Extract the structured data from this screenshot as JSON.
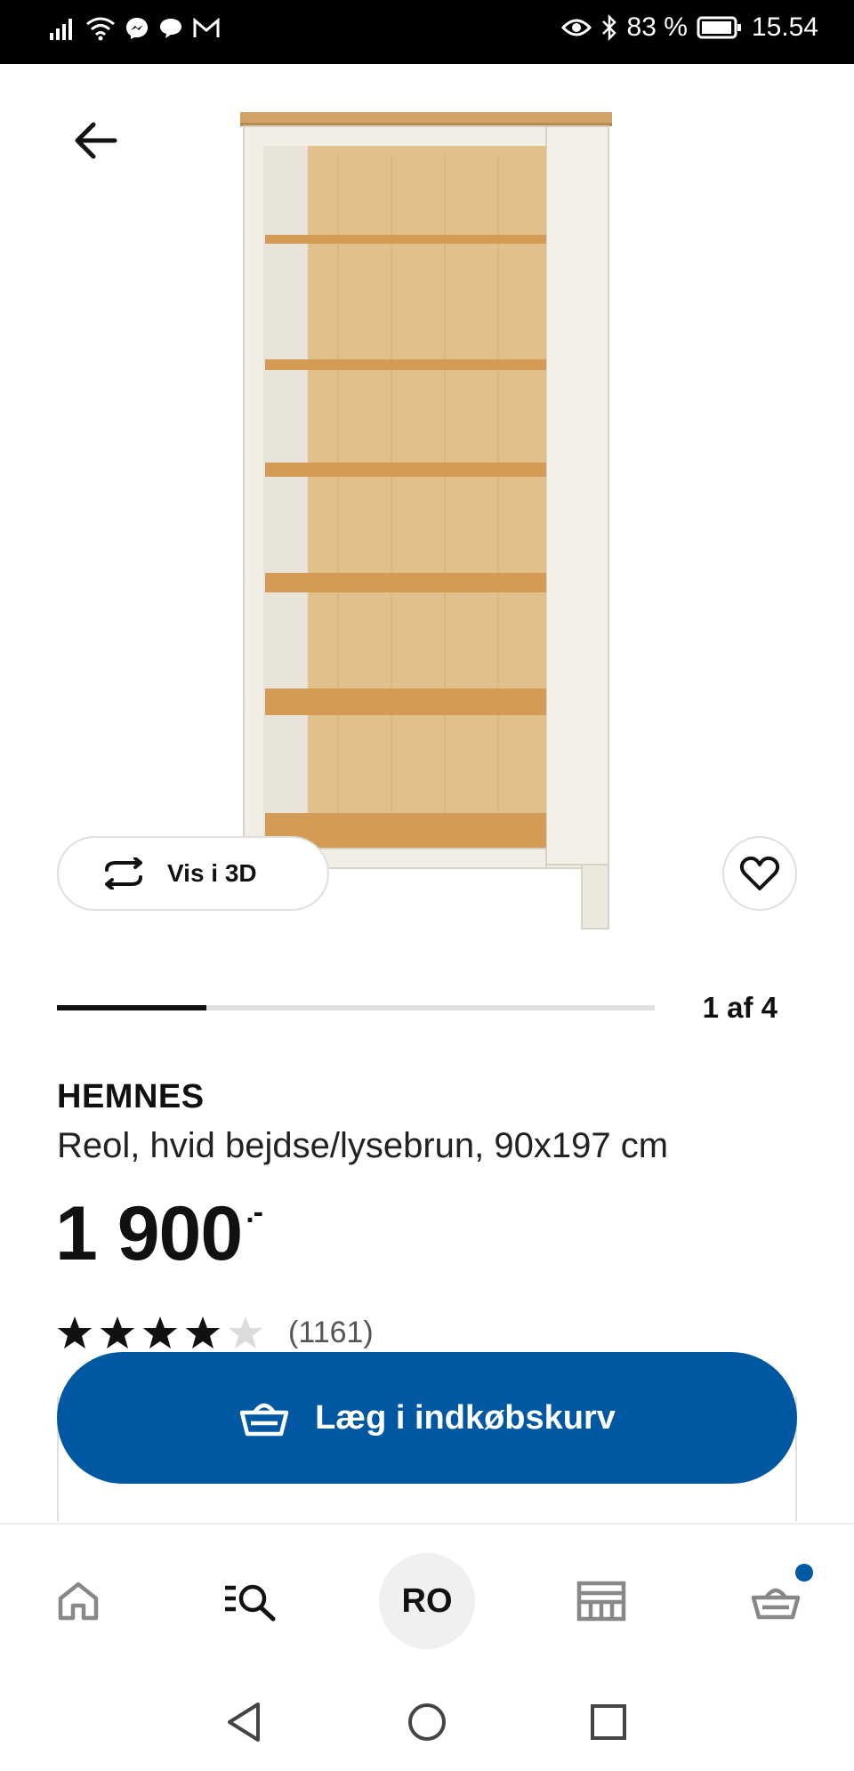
{
  "status_bar": {
    "battery": "83 %",
    "time": "15.54",
    "left_icons": [
      "signal-icon",
      "wifi-icon",
      "messenger-icon",
      "chat-icon",
      "gmail-icon"
    ],
    "right_icons": [
      "eye-icon",
      "bluetooth-icon",
      "battery-icon"
    ]
  },
  "gallery": {
    "vis3d_label": "Vis i 3D",
    "counter": "1 af 4",
    "current": 1,
    "total": 4
  },
  "product": {
    "name": "HEMNES",
    "description": "Reol, hvid bejdse/lysebrun, 90x197 cm",
    "price": "1 900",
    "price_suffix": ".-",
    "rating": 4,
    "rating_max": 5,
    "reviews": "(1161)"
  },
  "actions": {
    "add_to_cart_label": "Læg i indkøbskurv"
  },
  "bottom_nav": {
    "avatar_initials": "RO",
    "items": [
      "home-icon",
      "search-list-icon",
      "profile-avatar",
      "store-icon",
      "basket-icon"
    ],
    "basket_has_items": true
  },
  "colors": {
    "brand_blue": "#0058a3",
    "text": "#111111",
    "border": "#dfdfdf"
  }
}
